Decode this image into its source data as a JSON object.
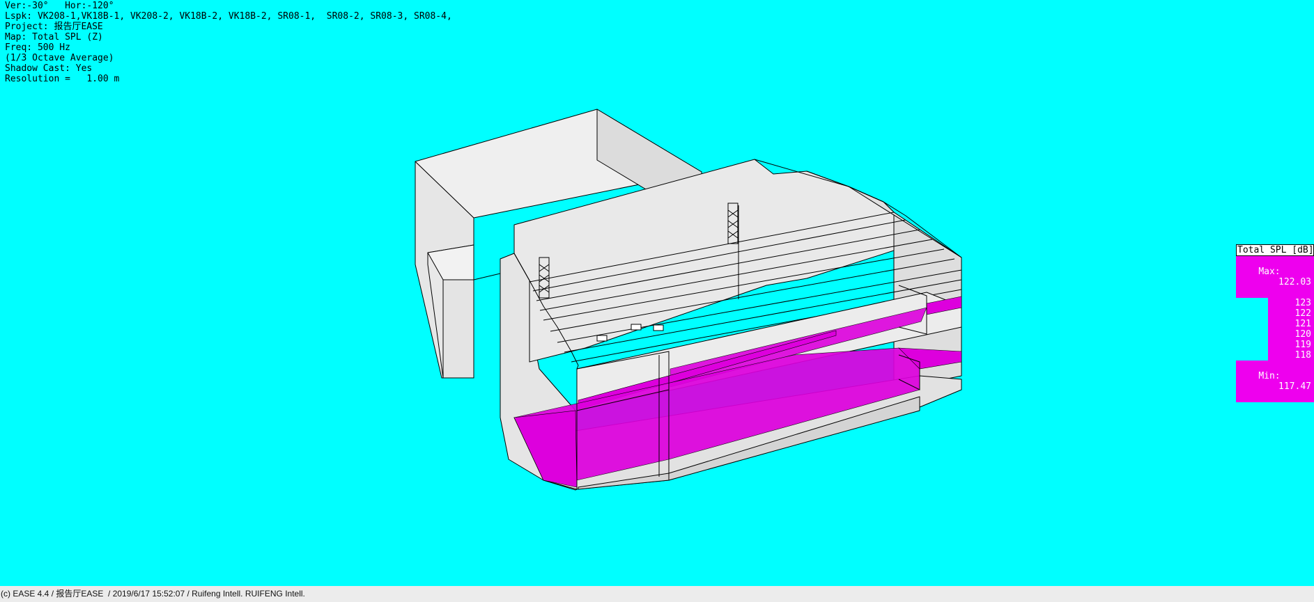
{
  "header": {
    "view": "Ver:-30°   Hor:-120°",
    "loudspeakers": "Lspk: VK208-1,VK18B-1, VK208-2, VK18B-2, VK18B-2, SR08-1,  SR08-2, SR08-3, SR08-4,",
    "project": "Project: 报告厅EASE",
    "map": "Map: Total SPL (Z)",
    "freq": "Freq: 500 Hz",
    "average": "(1/3 Octave Average)",
    "shadow": "Shadow Cast: Yes",
    "resolution": "Resolution =   1.00 m"
  },
  "legend": {
    "title": "Total SPL [dB]",
    "max_label": "Max:",
    "max_value": "122.03",
    "levels": [
      "123",
      "122",
      "121",
      "120",
      "119",
      "118"
    ],
    "min_label": "Min:",
    "min_value": "117.47",
    "color": "#ee00ee"
  },
  "colors": {
    "background": "#00ffff",
    "spl_fill": "#dd00dd",
    "wall": "#e4e4e4"
  },
  "footer": {
    "text": "(c) EASE 4.4 / 报告厅EASE  / 2019/6/17 15:52:07 / Ruifeng Intell. RUIFENG Intell."
  }
}
